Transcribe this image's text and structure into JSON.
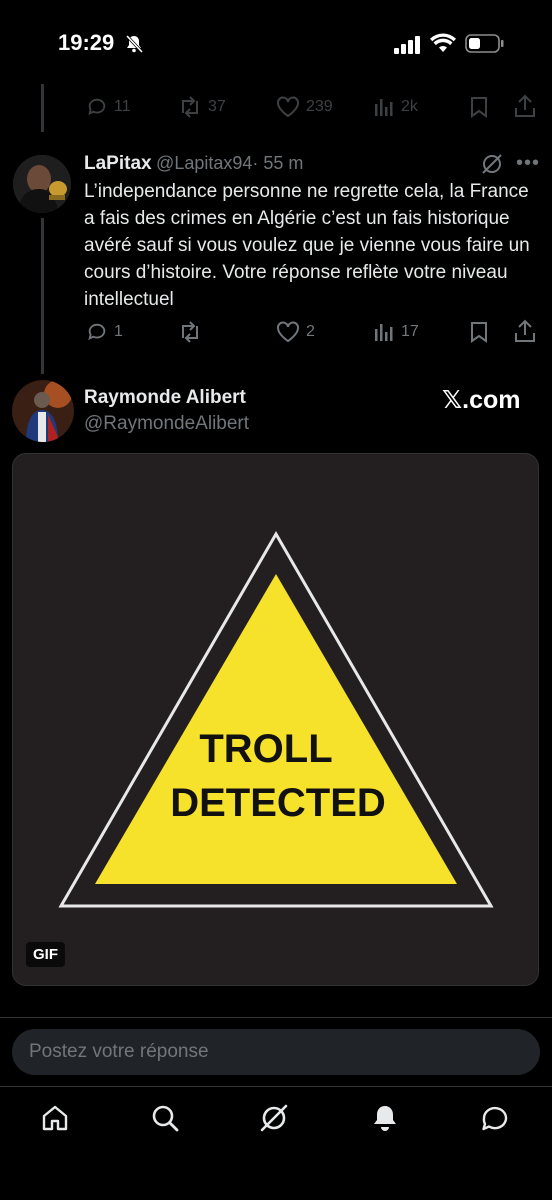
{
  "status_bar": {
    "time": "19:29"
  },
  "prev_tweet_actions": {
    "replies": "11",
    "retweets": "37",
    "likes": "239",
    "views": "2k"
  },
  "tweet": {
    "name": "LaPitax",
    "handle": "@Lapitax94",
    "time": "· 55 m",
    "text": "L’independance personne ne regrette cela, la France a fais des crimes en Algérie c’est un fais historique avéré sauf si vous voulez que je vienne vous faire un cours d’histoire. Votre réponse reflète votre niveau intellectuel",
    "replies": "1",
    "likes": "2",
    "views": "17"
  },
  "reply_tweet": {
    "name": "Raymonde Alibert",
    "handle": "@RaymondeAlibert",
    "brand": "𝕏.com",
    "media": {
      "sign_line1": "TROLL",
      "sign_line2": "DETECTED",
      "badge": "GIF"
    }
  },
  "reply_box": {
    "placeholder": "Postez votre réponse"
  },
  "colors": {
    "background": "#000000",
    "text": "#e7e9ea",
    "muted": "#71767b",
    "sign_yellow": "#f6e12b"
  },
  "bottom_nav": [
    "home-icon",
    "search-icon",
    "grok-icon",
    "notifications-icon",
    "messages-icon"
  ]
}
